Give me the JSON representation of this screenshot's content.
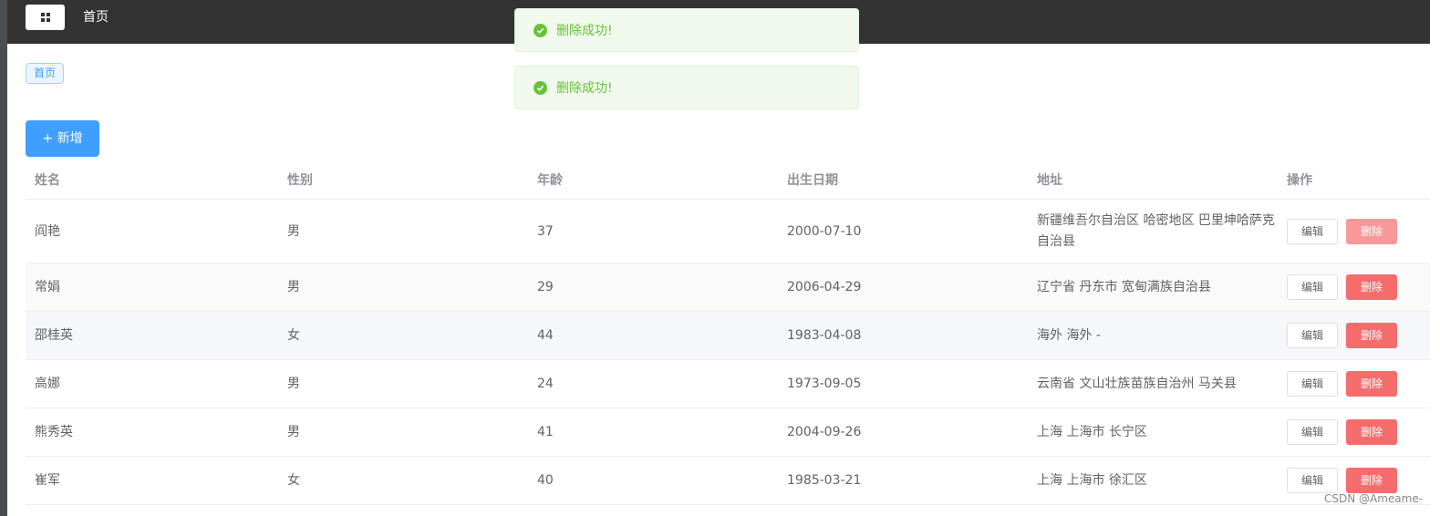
{
  "header": {
    "title": "首页",
    "menu_icon": "grid-icon",
    "background": "#333333"
  },
  "breadcrumb_tag": "首页",
  "toolbar": {
    "add_label": "+ 新增"
  },
  "toasts": [
    {
      "icon": "check-circle-icon",
      "message": "删除成功!"
    },
    {
      "icon": "check-circle-icon",
      "message": "删除成功!"
    }
  ],
  "table": {
    "headers": [
      "姓名",
      "性别",
      "年龄",
      "出生日期",
      "地址",
      "操作"
    ],
    "rows": [
      {
        "name": "阎艳",
        "gender": "男",
        "age": "37",
        "birth": "2000-07-10",
        "address": "新疆维吾尔自治区 哈密地区 巴里坤哈萨克自治县",
        "edit": "编辑",
        "delete": "删除"
      },
      {
        "name": "常娟",
        "gender": "男",
        "age": "29",
        "birth": "2006-04-29",
        "address": "辽宁省 丹东市 宽甸满族自治县",
        "edit": "编辑",
        "delete": "删除"
      },
      {
        "name": "邵桂英",
        "gender": "女",
        "age": "44",
        "birth": "1983-04-08",
        "address": "海外 海外 -",
        "edit": "编辑",
        "delete": "删除"
      },
      {
        "name": "高娜",
        "gender": "男",
        "age": "24",
        "birth": "1973-09-05",
        "address": "云南省 文山壮族苗族自治州 马关县",
        "edit": "编辑",
        "delete": "删除"
      },
      {
        "name": "熊秀英",
        "gender": "男",
        "age": "41",
        "birth": "2004-09-26",
        "address": "上海 上海市 长宁区",
        "edit": "编辑",
        "delete": "删除"
      },
      {
        "name": "崔军",
        "gender": "女",
        "age": "40",
        "birth": "1985-03-21",
        "address": "上海 上海市 徐汇区",
        "edit": "编辑",
        "delete": "删除"
      }
    ]
  },
  "watermark": "CSDN @Ameame-",
  "colors": {
    "primary": "#409eff",
    "danger": "#f56c6c",
    "success": "#67c23a",
    "success_bg": "#f0f9eb"
  }
}
